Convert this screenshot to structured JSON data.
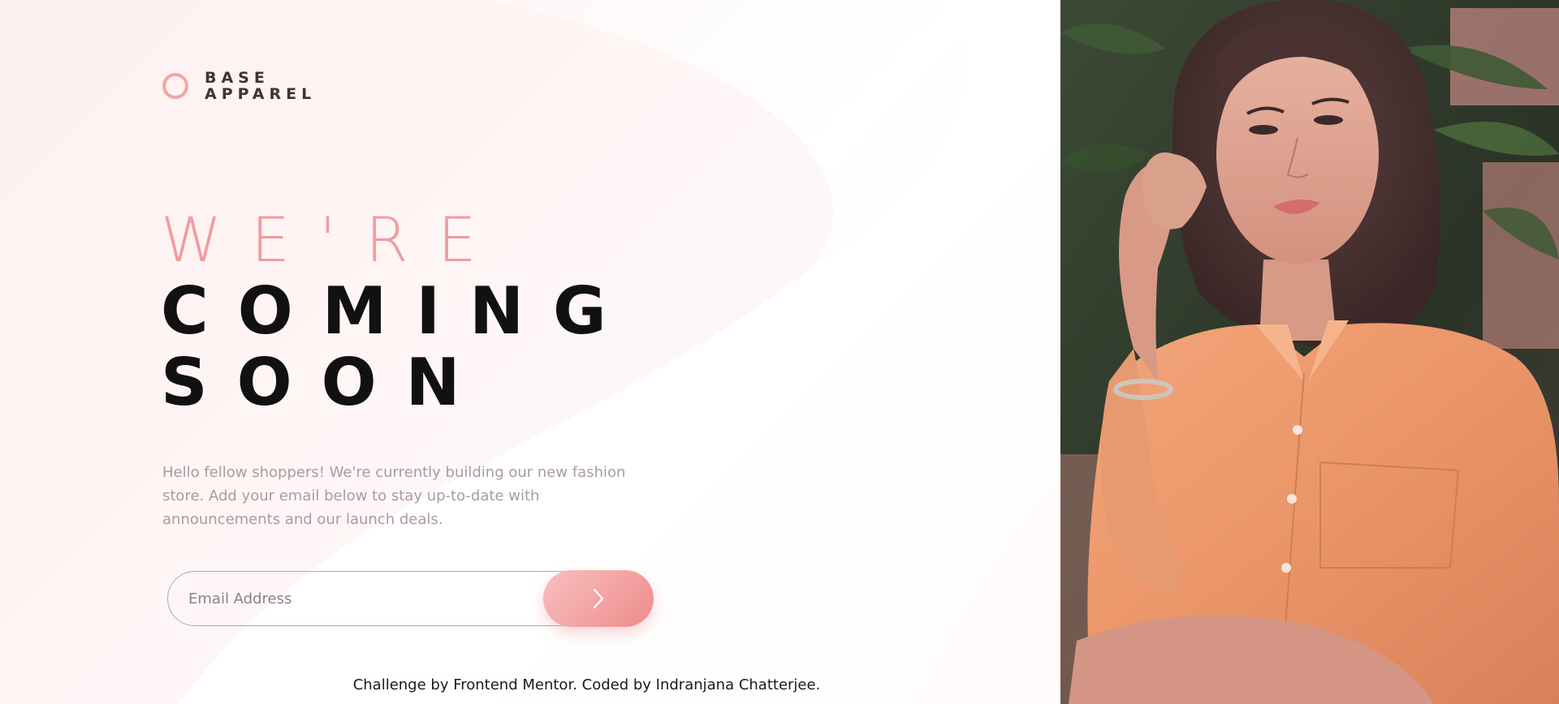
{
  "brand": {
    "line1": "BASE",
    "line2": "APPAREL",
    "accent_color": "#f0a7a4",
    "icon": "circle-logo-icon"
  },
  "headline": {
    "light": "WE'RE",
    "bold_line1": "COMING",
    "bold_line2": "SOON"
  },
  "description": "Hello fellow shoppers! We're currently building our new fashion store. Add your email below to stay up-to-date with announcements and our launch deals.",
  "email_form": {
    "placeholder": "Email Address",
    "submit_icon": "chevron-right-icon"
  },
  "attribution": "Challenge by Frontend Mentor. Coded by Indranjana Chatterjee.",
  "hero_image": {
    "alt": "hero-photo"
  },
  "colors": {
    "headline_light": "#ef9da0",
    "headline_bold": "#111111",
    "body_text": "#a99b9e",
    "button_gradient_start": "#f8bfbf",
    "button_gradient_end": "#ee8b8b"
  }
}
